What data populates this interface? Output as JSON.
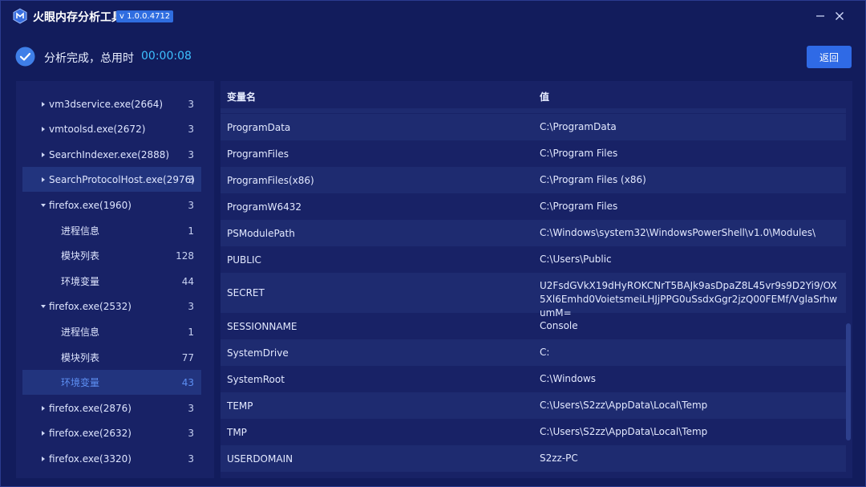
{
  "app": {
    "title": "火眼内存分析工具",
    "version": "v 1.0.0.4712",
    "brand_color": "#2f6de0"
  },
  "status": {
    "icon": "check-circle-icon",
    "text": "分析完成，总用时",
    "elapsed": "00:00:08",
    "back_label": "返回"
  },
  "tree": {
    "items": [
      {
        "label": "vm3dservice.exe(2664)",
        "count": "3",
        "expanded": false
      },
      {
        "label": "vmtoolsd.exe(2672)",
        "count": "3",
        "expanded": false
      },
      {
        "label": "SearchIndexer.exe(2888)",
        "count": "3",
        "expanded": false
      },
      {
        "label": "SearchProtocolHost.exe(2976)",
        "count": "3",
        "expanded": false
      },
      {
        "label": "firefox.exe(1960)",
        "count": "3",
        "expanded": true
      },
      {
        "label": "进程信息",
        "count": "1"
      },
      {
        "label": "模块列表",
        "count": "128"
      },
      {
        "label": "环境变量",
        "count": "44"
      },
      {
        "label": "firefox.exe(2532)",
        "count": "3",
        "expanded": true
      },
      {
        "label": "进程信息",
        "count": "1"
      },
      {
        "label": "模块列表",
        "count": "77"
      },
      {
        "label": "环境变量",
        "count": "43"
      },
      {
        "label": "firefox.exe(2876)",
        "count": "3",
        "expanded": false
      },
      {
        "label": "firefox.exe(2632)",
        "count": "3",
        "expanded": false
      },
      {
        "label": "firefox.exe(3320)",
        "count": "3",
        "expanded": false
      }
    ]
  },
  "table": {
    "columns": {
      "name": "变量名",
      "value": "值"
    },
    "rows": [
      {
        "name": "ProgramData",
        "value": "C:\\ProgramData"
      },
      {
        "name": "ProgramFiles",
        "value": "C:\\Program Files"
      },
      {
        "name": "ProgramFiles(x86)",
        "value": "C:\\Program Files (x86)"
      },
      {
        "name": "ProgramW6432",
        "value": "C:\\Program Files"
      },
      {
        "name": "PSModulePath",
        "value": "C:\\Windows\\system32\\WindowsPowerShell\\v1.0\\Modules\\"
      },
      {
        "name": "PUBLIC",
        "value": "C:\\Users\\Public"
      },
      {
        "name": "SECRET",
        "value": "U2FsdGVkX19dHyROKCNrT5BAJk9asDpaZ8L45vr9s9D2Yi9/OX5Xl6Emhd0VoietsmeiLHJjPPG0uSsdxGgr2jzQ00FEMf/VglaSrhwumM="
      },
      {
        "name": "SESSIONNAME",
        "value": "Console"
      },
      {
        "name": "SystemDrive",
        "value": "C:"
      },
      {
        "name": "SystemRoot",
        "value": "C:\\Windows"
      },
      {
        "name": "TEMP",
        "value": "C:\\Users\\S2zz\\AppData\\Local\\Temp"
      },
      {
        "name": "TMP",
        "value": "C:\\Users\\S2zz\\AppData\\Local\\Temp"
      },
      {
        "name": "USERDOMAIN",
        "value": "S2zz-PC"
      }
    ]
  }
}
